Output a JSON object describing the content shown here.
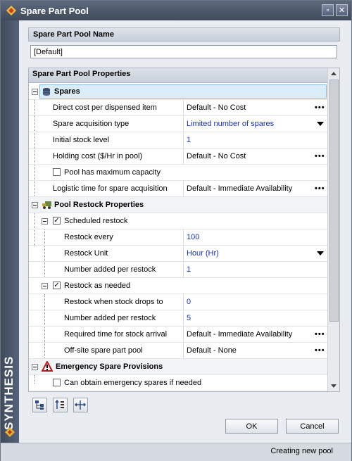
{
  "window": {
    "title": "Spare Part Pool",
    "minimize_glyph": "▫",
    "close_glyph": "✕"
  },
  "brand": {
    "text": "SYNTHESIS"
  },
  "name_section": {
    "header": "Spare Part Pool Name",
    "value": "[Default]"
  },
  "properties": {
    "header": "Spare Part Pool Properties",
    "spares": {
      "label": "Spares",
      "rows": [
        {
          "label": "Direct cost per dispensed item",
          "value": "Default - No Cost",
          "control": "dots"
        },
        {
          "label": "Spare acquisition type",
          "value": "Limited number of spares",
          "control": "dropdown"
        },
        {
          "label": "Initial stock level",
          "value": "1",
          "control": "none"
        },
        {
          "label": "Holding cost ($/Hr in pool)",
          "value": "Default - No Cost",
          "control": "dots"
        }
      ],
      "max_capacity_label": "Pool has maximum capacity",
      "logistic": {
        "label": "Logistic time for spare acquisition",
        "value": "Default - Immediate Availability",
        "control": "dots"
      }
    },
    "restock": {
      "label": "Pool Restock Properties",
      "scheduled": {
        "label": "Scheduled restock",
        "checked": true,
        "rows": [
          {
            "label": "Restock every",
            "value": "100",
            "control": "none"
          },
          {
            "label": "Restock Unit",
            "value": "Hour (Hr)",
            "control": "dropdown"
          },
          {
            "label": "Number added per restock",
            "value": "1",
            "control": "none"
          }
        ]
      },
      "as_needed": {
        "label": "Restock as needed",
        "checked": true,
        "rows": [
          {
            "label": "Restock when stock drops to",
            "value": "0",
            "control": "none"
          },
          {
            "label": "Number added per restock",
            "value": "5",
            "control": "none"
          },
          {
            "label": "Required time for stock arrival",
            "value": "Default - Immediate Availability",
            "control": "dots"
          },
          {
            "label": "Off-site spare part pool",
            "value": "Default - None",
            "control": "dots"
          }
        ]
      }
    },
    "emergency": {
      "label": "Emergency Spare Provisions",
      "checkbox_label": "Can obtain emergency spares if needed"
    }
  },
  "dots_glyph": "•••",
  "check_glyph": "✓",
  "buttons": {
    "ok": "OK",
    "cancel": "Cancel"
  },
  "status": {
    "text": "Creating new pool"
  },
  "colors": {
    "titlebar": "#4a5568",
    "value_blue": "#1a2fc4",
    "selected": "#d9ecf8"
  }
}
